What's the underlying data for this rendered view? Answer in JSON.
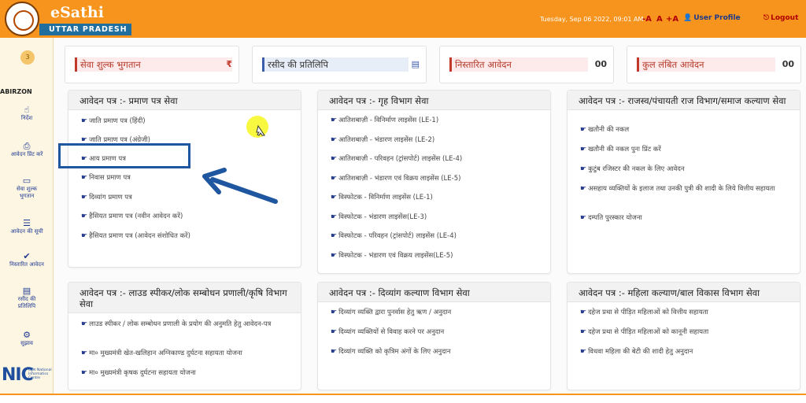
{
  "header": {
    "brand": "eSathi",
    "state": "UTTAR PRADESH",
    "datetime": "Tuesday, Sep 06 2022, 09:01 AM",
    "font_sizes": [
      "-A",
      "A",
      "+A"
    ],
    "profile_label": "User Profile",
    "logout_label": "Logout",
    "background_color": "#f7941d"
  },
  "sidebar": {
    "avatar": "3",
    "username": "ABIRZON",
    "items": [
      {
        "icon": "pointer-hand-icon",
        "label": "निर्देश"
      },
      {
        "icon": "printer-icon",
        "label": "आवेदन प्रिंट करें"
      },
      {
        "icon": "card-icon",
        "label": "सेवा शुल्क भुगतान"
      },
      {
        "icon": "list-icon",
        "label": "आवेदन की सूची"
      },
      {
        "icon": "check-icon",
        "label": "निस्तारित आवेदन"
      },
      {
        "icon": "document-icon",
        "label": "रसीद की प्रतिलिपि"
      },
      {
        "icon": "user-gear-icon",
        "label": "सुझाव"
      }
    ],
    "nic_logo": "NIC",
    "nic_text": "राष्ट्रीय National Informatics Centre"
  },
  "summary_cards": [
    {
      "label": "सेवा शुल्क भुगतान",
      "value": "₹"
    },
    {
      "label": "रसीद की प्रतिलिपि",
      "value": "▤"
    },
    {
      "label": "निस्तारित आवेदन",
      "value": "00"
    },
    {
      "label": "कुल लंबित आवेदन",
      "value": "00"
    }
  ],
  "panels": [
    {
      "title": "आवेदन पत्र :-  प्रमाण पत्र सेवा",
      "items": [
        "जाति प्रमाण पत्र (हिंदी)",
        "जाति प्रमाण पत्र (अंग्रेजी)",
        "आय प्रमाण पत्र",
        "निवास प्रमाण पत्र",
        "दिव्यांग प्रमाण पत्र",
        "हैसियत प्रमाण पत्र (नवीन आवेदन करें)",
        "हैसियत प्रमाण पत्र (आवेदन संशोधित करें)"
      ]
    },
    {
      "title": "आवेदन पत्र :-  गृह विभाग सेवा",
      "items": [
        "आतिशबाज़ी - विनिर्माण लाइसेंस (LE-1)",
        "आतिशबाज़ी - भंडारण लाइसेंस (LE-2)",
        "आतिशबाज़ी - परिवहन (ट्रांसपोर्ट) लाइसेंस (LE-4)",
        "आतिशबाज़ी - भंडारण एवं विक्रय लाइसेंस (LE-5)",
        "विस्फोटक - विनिर्माण लाइसेंस (LE-1)",
        "विस्फोटक - भंडारण लाइसेंस(LE-3)",
        "विस्फोटक - परिवहन (ट्रांसपोर्ट) लाइसेंस (LE-4)",
        "विस्फोटक - भंडारण एवं विक्रय लाइसेंस(LE-5)"
      ]
    },
    {
      "title": "आवेदन पत्र :-  राजस्व/पंचायती राज विभाग/समाज कल्याण सेवा",
      "items": [
        "खतौनी की नकल",
        "खतौनी की नकल पुनः प्रिंट करें",
        "कुटुंब रजिस्टर की नकल के लिए आवेदन",
        "असहाय व्यक्तियों के इलाज तथा उनकी पुत्री की शादी के लिये वित्तीय सहायता",
        "दम्पति पुरस्कार योजना"
      ]
    },
    {
      "title": "आवेदन पत्र :-  लाउड स्पीकर/लोक सम्बोधन प्रणाली/कृषि विभाग सेवा",
      "items": [
        "लाउड स्पीकर / लोक सम्बोधन प्रणाली के प्रयोग की अनुमति हेतु आवेदन-पत्र",
        "मा० मुख्यमंत्री खेत-खलिहान अग्निकाण्ड दुर्घटना सहायता योजना",
        "मा० मुख्यमंत्री कृषक दुर्घटना सहायता योजना"
      ]
    },
    {
      "title": "आवेदन पत्र :-  दिव्यांग कल्याण विभाग सेवा",
      "items": [
        "दिव्यांग व्यक्ति द्वारा पुनर्वास हेतु ऋण / अनुदान",
        "दिव्यांग व्यक्तियों से विवाह करने पर अनुदान",
        "दिव्यांग व्यक्ति को कृत्रिम अंगों के लिए अनुदान"
      ]
    },
    {
      "title": "आवेदन पत्र :-  महिला कल्याण/बाल विकास विभाग सेवा",
      "items": [
        "दहेज प्रथा से पीड़ित महिलाओं को वित्तीय सहायता",
        "दहेज प्रथा से पीड़ित महिलाओं को कानूनी सहायता",
        "विधवा महिला की बेटी की शादी हेतु अनुदान"
      ]
    }
  ]
}
